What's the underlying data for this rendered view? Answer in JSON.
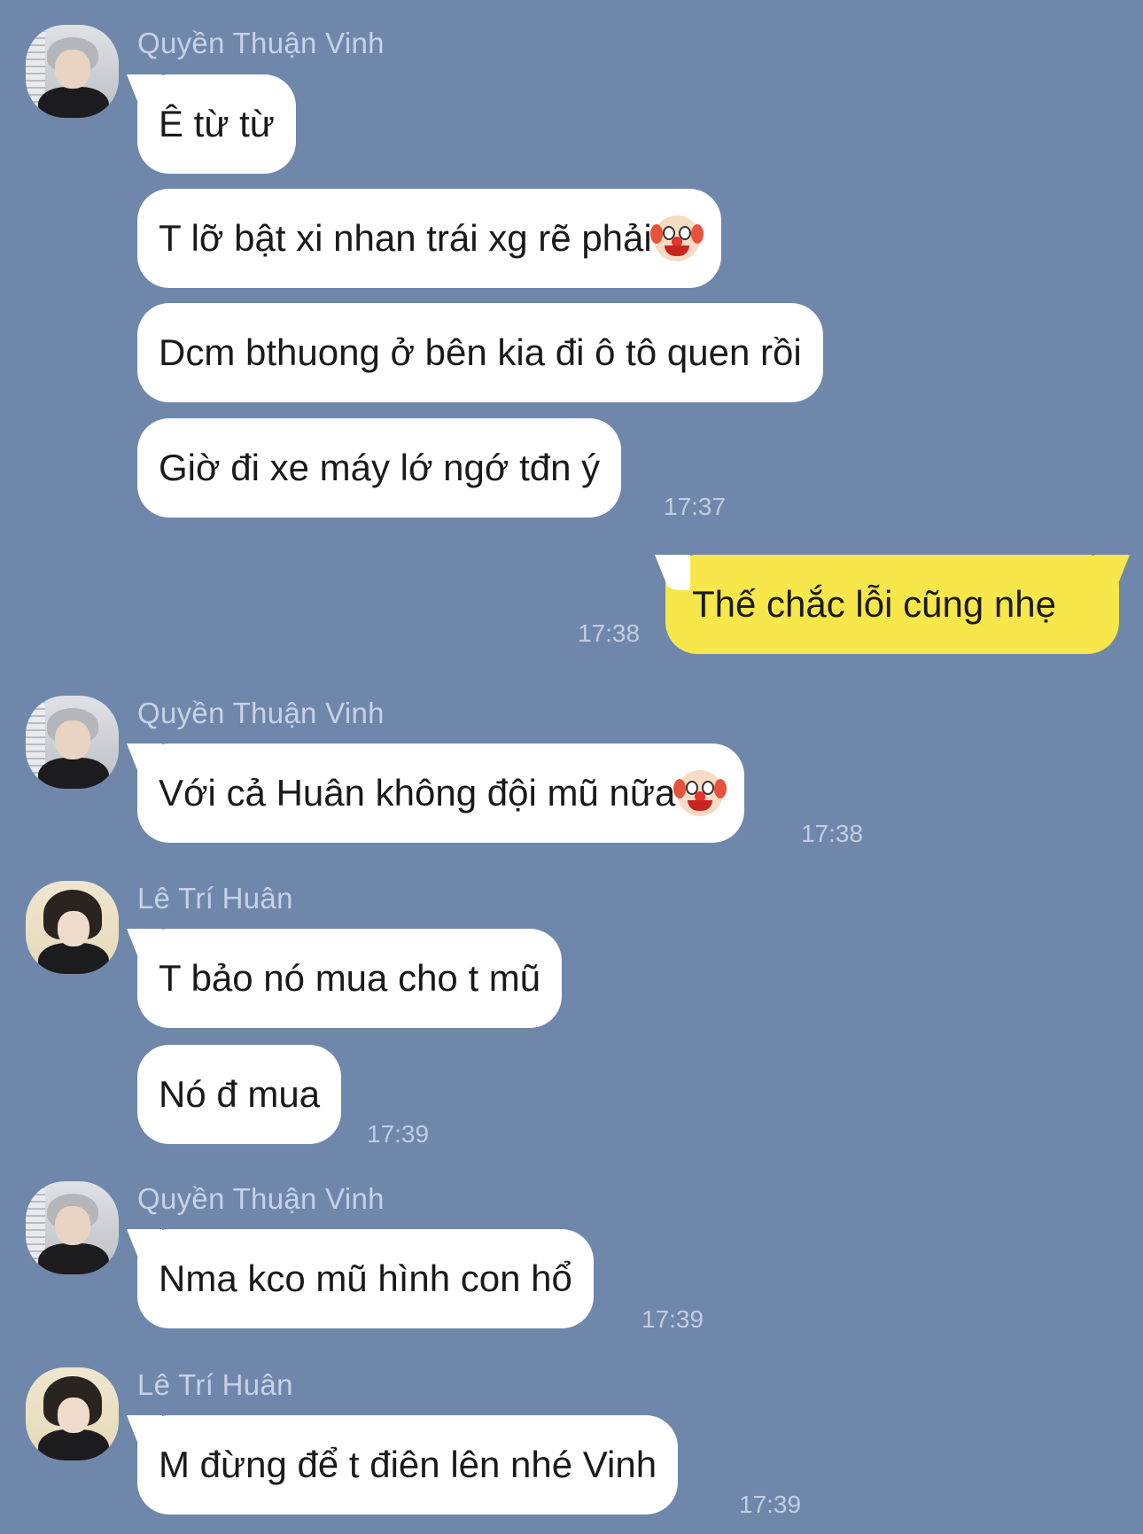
{
  "contacts": {
    "vinh": "Quyền Thuận Vinh",
    "huan": "Lê Trí Huân"
  },
  "messages": {
    "m1": "Ê từ từ",
    "m2": "T lỡ bật xi nhan trái xg rẽ phải",
    "m3": "Dcm bthuong ở bên kia đi ô tô quen rồi",
    "m4": "Giờ đi xe máy lớ ngớ tđn ý",
    "t1": "17:37",
    "m5": "Thế chắc lỗi cũng nhẹ",
    "t2": "17:38",
    "m6": "Với cả Huân không đội mũ nữa",
    "t3": "17:38",
    "m7": "T bảo nó mua cho t mũ",
    "m8": "Nó đ mua",
    "t4": "17:39",
    "m9": "Nma kco mũ hình con hổ",
    "t5": "17:39",
    "m10": "M đừng để t điên lên nhé Vinh",
    "t6": "17:39"
  },
  "emoji": "clown-face",
  "colors": {
    "background": "#6f87ab",
    "incoming_bubble": "#ffffff",
    "outgoing_bubble": "#f8e74a"
  }
}
